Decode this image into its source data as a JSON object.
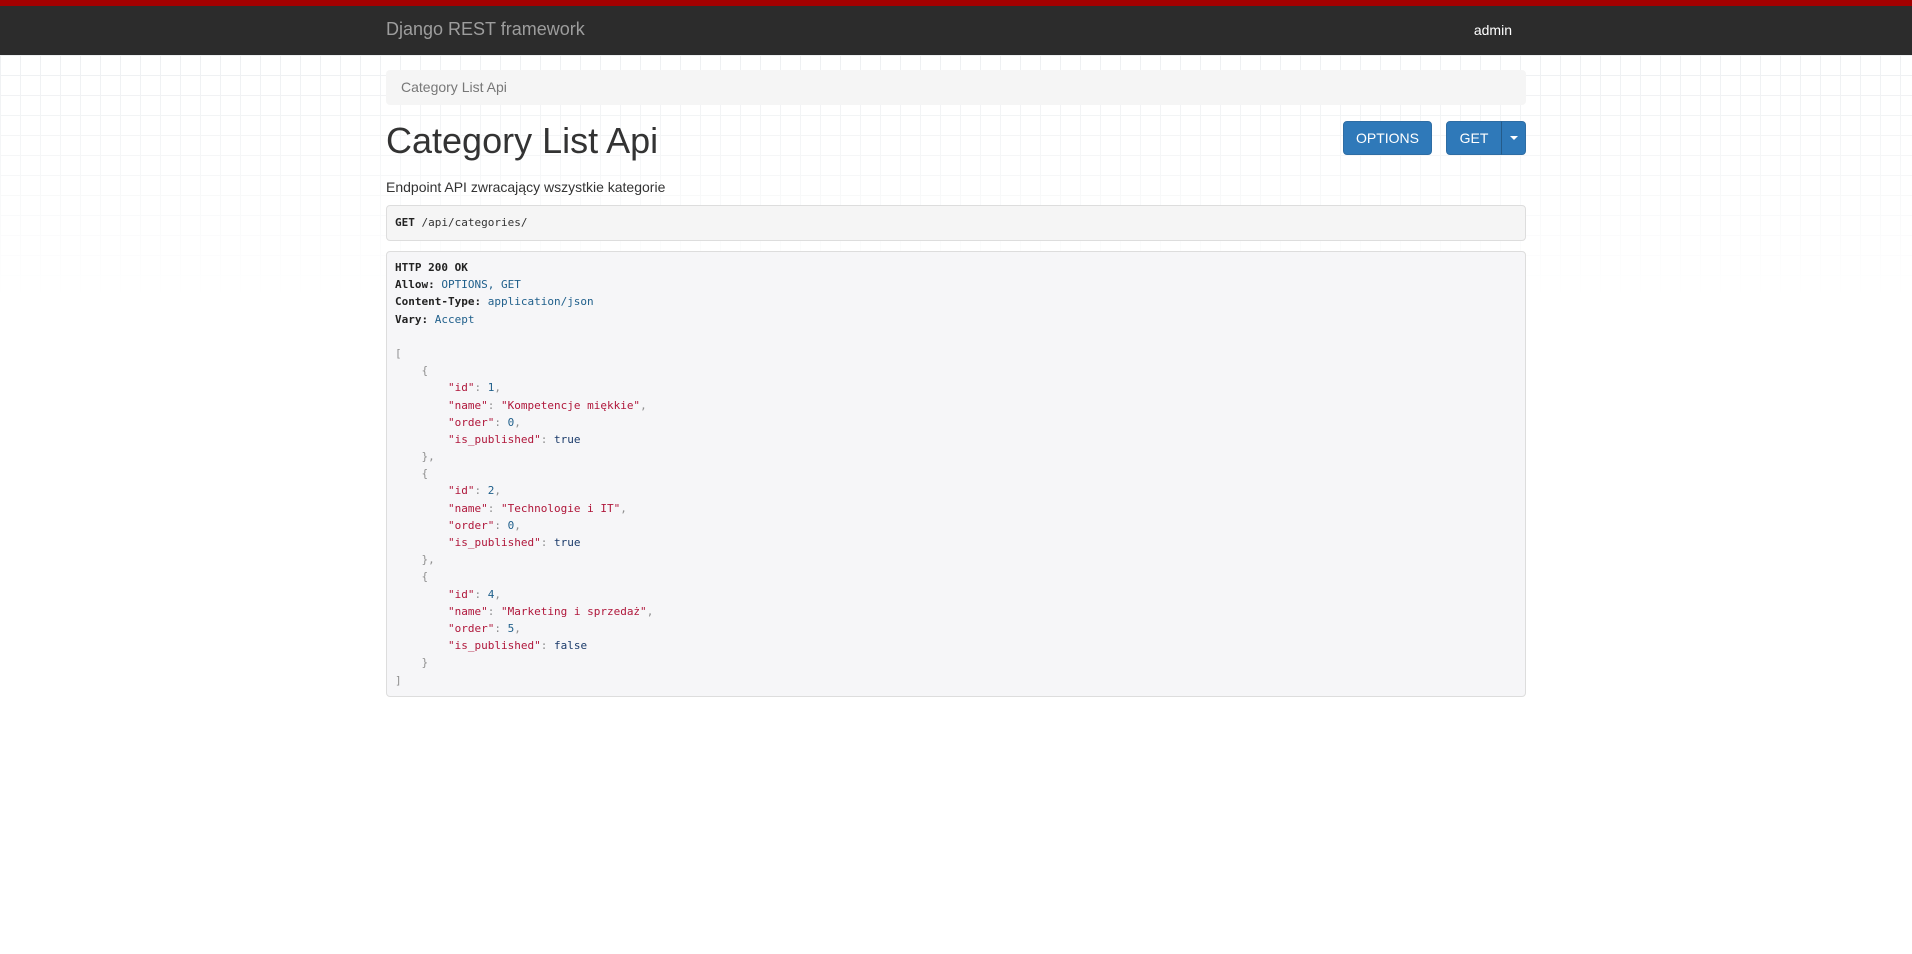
{
  "navbar": {
    "brand": "Django REST framework",
    "user": "admin"
  },
  "breadcrumb": "Category List Api",
  "page": {
    "title": "Category List Api",
    "description": "Endpoint API zwracający wszystkie kategorie"
  },
  "buttons": {
    "options": "OPTIONS",
    "get": "GET"
  },
  "request": {
    "method": "GET",
    "path": "/api/categories/"
  },
  "response": {
    "status": "HTTP 200 OK",
    "headers": [
      {
        "name": "Allow:",
        "value": "OPTIONS, GET"
      },
      {
        "name": "Content-Type:",
        "value": "application/json"
      },
      {
        "name": "Vary:",
        "value": "Accept"
      }
    ],
    "items": [
      {
        "id": "1",
        "name": "\"Kompetencje miękkie\"",
        "order": "0",
        "is_published": "true"
      },
      {
        "id": "2",
        "name": "\"Technologie i IT\"",
        "order": "0",
        "is_published": "true"
      },
      {
        "id": "4",
        "name": "\"Marketing i sprzedaż\"",
        "order": "5",
        "is_published": "false"
      }
    ],
    "keys": {
      "id": "\"id\"",
      "name": "\"name\"",
      "order": "\"order\"",
      "is_published": "\"is_published\""
    }
  },
  "colors": {
    "navbar_bg": "#2c2c2c",
    "navbar_accent": "#a30000",
    "button": "#2f79b9"
  }
}
